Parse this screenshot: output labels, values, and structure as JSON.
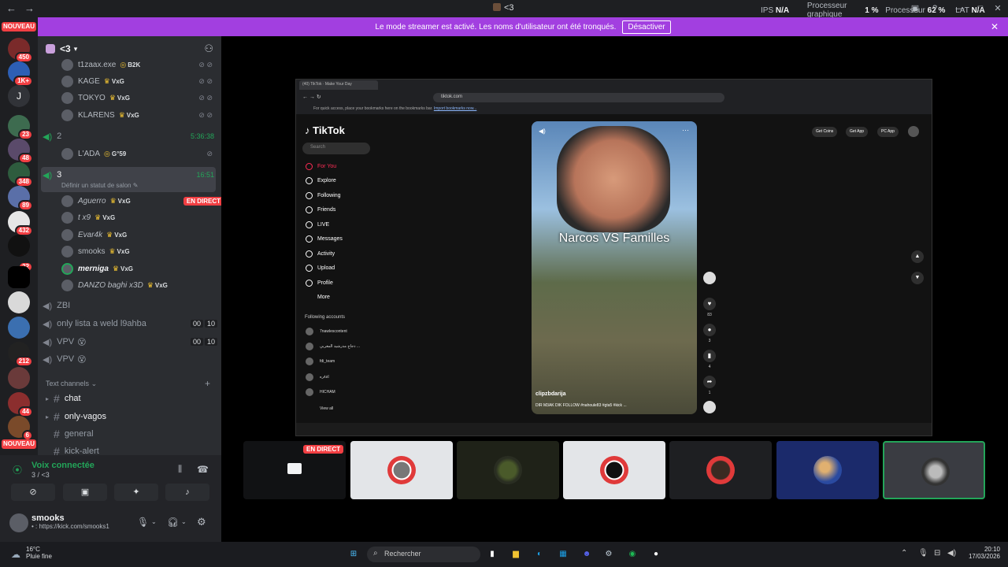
{
  "window": {
    "title": "<3",
    "nav_back": "←",
    "nav_forward": "→"
  },
  "stats": {
    "ips_label": "IPS",
    "ips_value": "N/A",
    "gpu_label_1": "Processeur",
    "gpu_label_2": "graphique",
    "gpu_value": "1 %",
    "cpu_label": "Processeur",
    "cpu_value": "62 %",
    "lat_label": "LAT",
    "lat_value": "N/A"
  },
  "banner": {
    "text": "Le mode streamer est activé. Les noms d'utilisateur ont été tronqués.",
    "button": "Désactiver"
  },
  "servers": {
    "new_label": "NOUVEAU",
    "badges": [
      "450",
      "1K+",
      "23",
      "48",
      "348",
      "89",
      "432",
      "22",
      "212",
      "44",
      "6"
    ],
    "letter": "J"
  },
  "server": {
    "name": "<3"
  },
  "voice_channels": {
    "ch2": {
      "name": "2",
      "time": "5:36:38"
    },
    "ch3": {
      "name": "3",
      "time": "16:51",
      "status": "Définir un statut de salon"
    },
    "zbi": {
      "name": "ZBI"
    },
    "lista": {
      "name": "only lista a weld l9ahba",
      "count_a": "00",
      "count_b": "10"
    },
    "vpv1": {
      "name": "VPV",
      "count_a": "00",
      "count_b": "10"
    },
    "vpv2": {
      "name": "VPV"
    }
  },
  "users_top": [
    {
      "name": "t1zaax.exe",
      "tag": "B2K"
    },
    {
      "name": "KAGE",
      "tag": "VxG"
    },
    {
      "name": "TOKYO",
      "tag": "VxG"
    },
    {
      "name": "KLARENS",
      "tag": "VxG"
    }
  ],
  "users_ch2": [
    {
      "name": "L'ADA",
      "tag": "G°59"
    }
  ],
  "users_ch3": [
    {
      "name": "Aguerro",
      "tag": "VxG",
      "live": "EN DIRECT"
    },
    {
      "name": "t x9",
      "tag": "VxG"
    },
    {
      "name": "Evar4k",
      "tag": "VxG"
    },
    {
      "name": "smooks",
      "tag": "VxG"
    },
    {
      "name": "merniga",
      "tag": "VxG"
    },
    {
      "name": "DANZO baghi x3D",
      "tag": "VxG"
    }
  ],
  "text_channels": {
    "header": "Text channels",
    "items": [
      "chat",
      "only-vagos",
      "general",
      "kick-alert"
    ]
  },
  "voice_panel": {
    "status": "Voix connectée",
    "sub": "3 / <3"
  },
  "user_panel": {
    "name": "smooks",
    "status": "• : https://kick.com/smooks1"
  },
  "browser": {
    "tab": "(40) TikTok · Make Your Day",
    "url": "tiktok.com",
    "bookmarks": "For quick access, place your bookmarks here on the bookmarks bar.",
    "bookmarks_link": "Import bookmarks now..."
  },
  "tiktok": {
    "logo": "TikTok",
    "search": "Search",
    "nav": [
      "For You",
      "Explore",
      "Following",
      "Friends",
      "LIVE",
      "Messages",
      "Activity",
      "Upload",
      "Profile",
      "More"
    ],
    "following_header": "Following accounts",
    "accounts": [
      "7nawlescontent",
      "دجاج مدرشيد المغربي ...",
      "fdi_team",
      "ا۸۸ره",
      "HICHAM"
    ],
    "view_all": "View all",
    "pills": [
      "Get Coins",
      "Get App",
      "PC App"
    ],
    "video_title": "Narcos VS Familles",
    "video_user": "clipzbdarija",
    "video_desc": "DIR M3AK DIK FOLLOW   #nahoule83 #gta5 #kick ...",
    "counts": [
      "83",
      "3",
      "4",
      "1"
    ]
  },
  "tiles": {
    "live_label": "EN DIRECT"
  },
  "taskbar": {
    "temp": "16°C",
    "weather": "Pluie fine",
    "search": "Rechercher",
    "time": "20:10",
    "date": "17/03/2026"
  }
}
